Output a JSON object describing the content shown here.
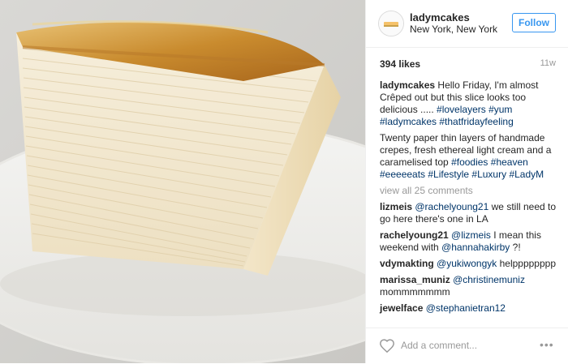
{
  "post": {
    "username": "ladymcakes",
    "location": "New York, New York",
    "follow_label": "Follow",
    "likes": "394 likes",
    "age": "11w"
  },
  "caption": {
    "author": "ladymcakes",
    "text1": "Hello Friday, I'm almost Crêped out but this slice looks too delicious .....",
    "tags1": "#lovelayers #yum #ladymcakes #thatfridayfeeling",
    "text2": "Twenty paper thin layers of handmade crepes, fresh ethereal light cream and a caramelised top",
    "tags2": "#foodies #heaven #eeeeeats #Lifestyle #Luxury #LadyM"
  },
  "view_all": "view all 25 comments",
  "comments": [
    {
      "author": "lizmeis",
      "mention": "@rachelyoung21",
      "text": "we still need to go here there's one in LA"
    },
    {
      "author": "rachelyoung21",
      "mention": "@lizmeis",
      "text": "I mean this weekend with",
      "mention2": "@hannahakirby",
      "text2": "?!"
    },
    {
      "author": "vdymakting",
      "mention": "@yukiwongyk",
      "text": "helpppppppp"
    },
    {
      "author": "marissa_muniz",
      "mention": "@christinemuniz",
      "text": "mommmmmmm"
    },
    {
      "author": "jewelface",
      "mention": "@stephanietran12",
      "text": ""
    }
  ],
  "footer": {
    "add_comment": "Add a comment...",
    "more": "•••"
  },
  "icons": [
    "heart-icon",
    "more-options-icon",
    "avatar-logo"
  ],
  "colors": {
    "link": "#003569",
    "follow": "#3897f0",
    "muted": "#999999"
  }
}
